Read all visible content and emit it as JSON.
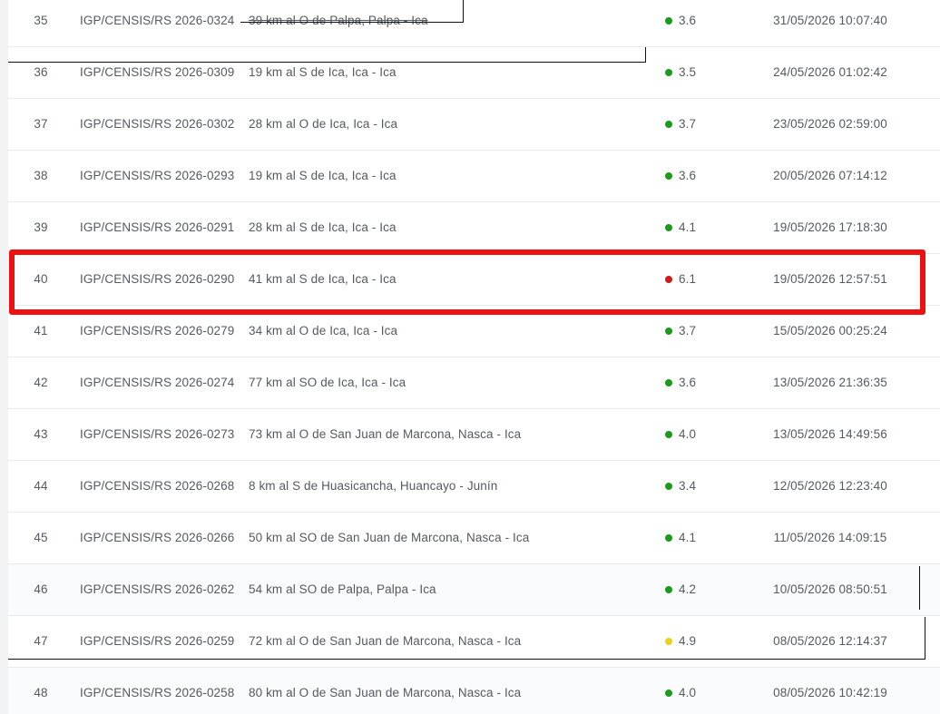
{
  "rows": [
    {
      "num": "35",
      "code": "IGP/CENSIS/RS 2026-0324",
      "reference": "39 km al O de Palpa, Palpa - Ica",
      "magnitude": "3.6",
      "level_color": "#1a9c1a",
      "datetime": "31/05/2026 10:07:40"
    },
    {
      "num": "36",
      "code": "IGP/CENSIS/RS 2026-0309",
      "reference": "19 km al S de Ica, Ica - Ica",
      "magnitude": "3.5",
      "level_color": "#1a9c1a",
      "datetime": "24/05/2026 01:02:42"
    },
    {
      "num": "37",
      "code": "IGP/CENSIS/RS 2026-0302",
      "reference": "28 km al O de Ica, Ica - Ica",
      "magnitude": "3.7",
      "level_color": "#1a9c1a",
      "datetime": "23/05/2026 02:59:00"
    },
    {
      "num": "38",
      "code": "IGP/CENSIS/RS 2026-0293",
      "reference": "19 km al S de Ica, Ica - Ica",
      "magnitude": "3.6",
      "level_color": "#1a9c1a",
      "datetime": "20/05/2026 07:14:12"
    },
    {
      "num": "39",
      "code": "IGP/CENSIS/RS 2026-0291",
      "reference": "28 km al S de Ica, Ica - Ica",
      "magnitude": "4.1",
      "level_color": "#1a9c1a",
      "datetime": "19/05/2026 17:18:30"
    },
    {
      "num": "40",
      "code": "IGP/CENSIS/RS 2026-0290",
      "reference": "41 km al S de Ica, Ica - Ica",
      "magnitude": "6.1",
      "level_color": "#d11a1a",
      "datetime": "19/05/2026 12:57:51"
    },
    {
      "num": "41",
      "code": "IGP/CENSIS/RS 2026-0279",
      "reference": "34 km al O de Ica, Ica - Ica",
      "magnitude": "3.7",
      "level_color": "#1a9c1a",
      "datetime": "15/05/2026 00:25:24"
    },
    {
      "num": "42",
      "code": "IGP/CENSIS/RS 2026-0274",
      "reference": "77 km al SO de Ica, Ica - Ica",
      "magnitude": "3.6",
      "level_color": "#1a9c1a",
      "datetime": "13/05/2026 21:36:35"
    },
    {
      "num": "43",
      "code": "IGP/CENSIS/RS 2026-0273",
      "reference": "73 km al O de San Juan de Marcona, Nasca - Ica",
      "magnitude": "4.0",
      "level_color": "#1a9c1a",
      "datetime": "13/05/2026 14:49:56"
    },
    {
      "num": "44",
      "code": "IGP/CENSIS/RS 2026-0268",
      "reference": "8 km al S de Huasicancha, Huancayo - Junín",
      "magnitude": "3.4",
      "level_color": "#1a9c1a",
      "datetime": "12/05/2026 12:23:40"
    },
    {
      "num": "45",
      "code": "IGP/CENSIS/RS 2026-0266",
      "reference": "50 km al SO de San Juan de Marcona, Nasca - Ica",
      "magnitude": "4.1",
      "level_color": "#1a9c1a",
      "datetime": "11/05/2026 14:09:15"
    },
    {
      "num": "46",
      "code": "IGP/CENSIS/RS 2026-0262",
      "reference": "54 km al SO de Palpa, Palpa - Ica",
      "magnitude": "4.2",
      "level_color": "#1a9c1a",
      "datetime": "10/05/2026 08:50:51"
    },
    {
      "num": "47",
      "code": "IGP/CENSIS/RS 2026-0259",
      "reference": "72 km al O de San Juan de Marcona, Nasca - Ica",
      "magnitude": "4.9",
      "level_color": "#e8d21a",
      "datetime": "08/05/2026 12:14:37"
    },
    {
      "num": "48",
      "code": "IGP/CENSIS/RS 2026-0258",
      "reference": "80 km al O de San Juan de Marcona, Nasca - Ica",
      "magnitude": "4.0",
      "level_color": "#1a9c1a",
      "datetime": "08/05/2026 10:42:19"
    }
  ],
  "highlight_color": "#ee1111"
}
